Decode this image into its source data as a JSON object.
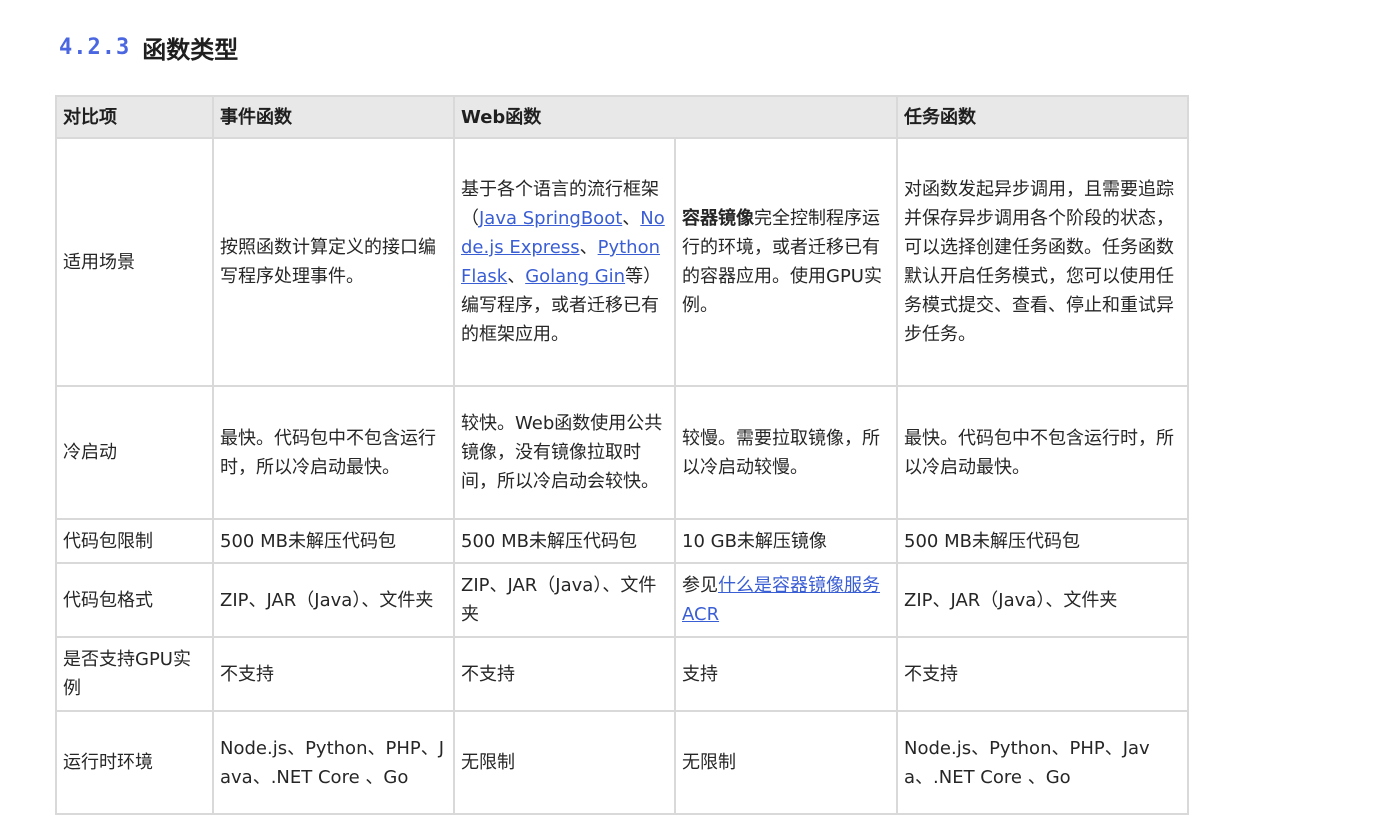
{
  "heading": {
    "number": "4.2.3",
    "title": "函数类型"
  },
  "table": {
    "headers": {
      "item": "对比项",
      "event": "事件函数",
      "web": "Web函数",
      "task": "任务函数"
    },
    "scene": {
      "label": "适用场景",
      "event": "按照函数计算定义的接口编写程序处理事件。",
      "web_a_prefix": "基于各个语言的流行框架（",
      "web_a_link1": "Java SpringBoot",
      "web_a_sep1": "、",
      "web_a_link2": "Node.js Express",
      "web_a_sep2": "、",
      "web_a_link3": "Python Flask",
      "web_a_sep3": "、",
      "web_a_link4": "Golang Gin",
      "web_a_suffix": "等）编写程序，或者迁移已有的框架应用。",
      "web_b_bold": "容器镜像",
      "web_b_text": "完全控制程序运行的环境，或者迁移已有的容器应用。使用GPU实例。",
      "task": "对函数发起异步调用，且需要追踪并保存异步调用各个阶段的状态，可以选择创建任务函数。任务函数默认开启任务模式，您可以使用任务模式提交、查看、停止和重试异步任务。"
    },
    "cold": {
      "label": "冷启动",
      "event": "最快。代码包中不包含运行时，所以冷启动最快。",
      "web_a": "较快。Web函数使用公共镜像，没有镜像拉取时间，所以冷启动会较快。",
      "web_b": "较慢。需要拉取镜像，所以冷启动较慢。",
      "task": "最快。代码包中不包含运行时，所以冷启动最快。"
    },
    "size": {
      "label": "代码包限制",
      "event": "500 MB未解压代码包",
      "web_a": "500 MB未解压代码包",
      "web_b": "10 GB未解压镜像",
      "task": "500 MB未解压代码包"
    },
    "format": {
      "label": "代码包格式",
      "event": "ZIP、JAR（Java）、文件夹",
      "web_a": "ZIP、JAR（Java）、文件夹",
      "web_b_prefix": "参见",
      "web_b_link": "什么是容器镜像服务ACR",
      "task": "ZIP、JAR（Java）、文件夹"
    },
    "gpu": {
      "label": "是否支持GPU实例",
      "event": "不支持",
      "web_a": "不支持",
      "web_b": "支持",
      "task": "不支持"
    },
    "runtime": {
      "label": "运行时环境",
      "event": "Node.js、Python、PHP、Java、.NET Core 、Go",
      "web_a": "无限制",
      "web_b": "无限制",
      "task": "Node.js、Python、PHP、Java、.NET Core 、Go"
    }
  }
}
